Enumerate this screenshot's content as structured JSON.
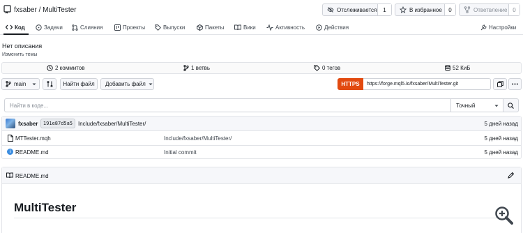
{
  "repo": {
    "owner": "fxsaber",
    "name": "MultiTester",
    "separator": "/"
  },
  "header_actions": {
    "watch_label": "Отслеживается",
    "watch_count": "1",
    "star_label": "В избранное",
    "star_count": "0",
    "fork_label": "Ответвление",
    "fork_count": "0"
  },
  "tabs": [
    {
      "label": "Код",
      "icon": "code-icon"
    },
    {
      "label": "Задачи",
      "icon": "issue-icon"
    },
    {
      "label": "Слияния",
      "icon": "pull-request-icon"
    },
    {
      "label": "Проекты",
      "icon": "project-icon"
    },
    {
      "label": "Выпуски",
      "icon": "tag-icon"
    },
    {
      "label": "Пакеты",
      "icon": "package-icon"
    },
    {
      "label": "Вики",
      "icon": "book-icon"
    },
    {
      "label": "Активность",
      "icon": "pulse-icon"
    },
    {
      "label": "Действия",
      "icon": "play-icon"
    },
    {
      "label": "Настройки",
      "icon": "tools-icon"
    }
  ],
  "description": {
    "text": "Нет описания",
    "topics_link": "Изменить темы"
  },
  "stats": {
    "commits": "2 коммитов",
    "branches": "1 ветвь",
    "tags": "0 тегов",
    "size": "52 КиБ"
  },
  "toolbar": {
    "branch": "main",
    "find_file": "Найти файл",
    "add_file": "Добавить файл",
    "protocol": "HTTPS",
    "clone_url": "https://forge.mql5.io/fxsaber/MultiTester.git"
  },
  "search": {
    "placeholder": "Найти в коде...",
    "mode": "Точный"
  },
  "latest_commit": {
    "author": "fxsaber",
    "sha": "191e87d5a5",
    "message": "Include/fxsaber/MultiTester/",
    "age": "5 дней назад"
  },
  "files": [
    {
      "name": "MTTester.mqh",
      "message": "Include/fxsaber/MultiTester/",
      "age": "5 дней назад",
      "icon": "file-icon"
    },
    {
      "name": "README.md",
      "message": "Initial commit",
      "age": "5 дней назад",
      "icon": "info-icon"
    }
  ],
  "readme": {
    "filename": "README.md",
    "heading": "MultiTester"
  },
  "colors": {
    "accent": "#e24a10",
    "info": "#3b8de0",
    "border": "#d0d3d9"
  }
}
